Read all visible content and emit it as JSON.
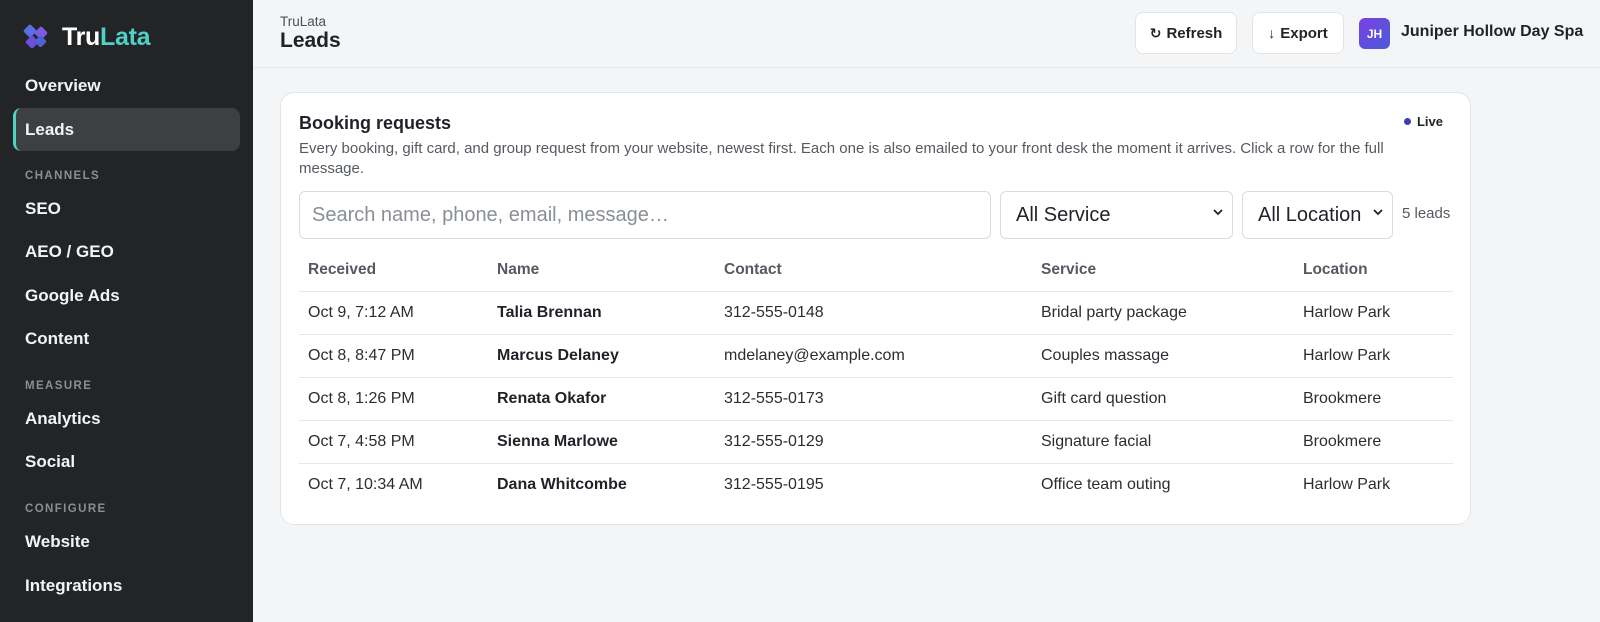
{
  "brand": {
    "name_part1": "Tru",
    "name_part2": "Lata",
    "accent": "#4fd1c5"
  },
  "sidebar": {
    "items": [
      {
        "label": "Overview"
      },
      {
        "label": "Leads",
        "active": true
      }
    ],
    "sections": [
      {
        "title": "CHANNELS",
        "items": [
          {
            "label": "SEO"
          },
          {
            "label": "AEO / GEO"
          },
          {
            "label": "Google Ads"
          },
          {
            "label": "Content"
          }
        ]
      },
      {
        "title": "MEASURE",
        "items": [
          {
            "label": "Analytics"
          },
          {
            "label": "Social"
          }
        ]
      },
      {
        "title": "CONFIGURE",
        "items": [
          {
            "label": "Website"
          },
          {
            "label": "Integrations"
          }
        ]
      }
    ]
  },
  "header": {
    "breadcrumb": "TruLata",
    "title": "Leads",
    "refresh_label": "Refresh",
    "export_label": "Export",
    "account": {
      "initials": "JH",
      "name": "Juniper Hollow Day Spa"
    }
  },
  "card": {
    "title": "Booking requests",
    "live_label": "Live",
    "description": "Every booking, gift card, and group request from your website, newest first. Each one is also emailed to your front desk the moment it arrives. Click a row for the full message.",
    "search_placeholder": "Search name, phone, email, message…",
    "service_filter": "All Service",
    "location_filter": "All Location",
    "lead_count": "5 leads"
  },
  "table": {
    "columns": [
      "Received",
      "Name",
      "Contact",
      "Service",
      "Location"
    ],
    "rows": [
      {
        "received": "Oct 9, 7:12 AM",
        "name": "Talia Brennan",
        "contact": "312-555-0148",
        "service": "Bridal party package",
        "location": "Harlow Park"
      },
      {
        "received": "Oct 8, 8:47 PM",
        "name": "Marcus Delaney",
        "contact": "mdelaney@example.com",
        "service": "Couples massage",
        "location": "Harlow Park"
      },
      {
        "received": "Oct 8, 1:26 PM",
        "name": "Renata Okafor",
        "contact": "312-555-0173",
        "service": "Gift card question",
        "location": "Brookmere"
      },
      {
        "received": "Oct 7, 4:58 PM",
        "name": "Sienna Marlowe",
        "contact": "312-555-0129",
        "service": "Signature facial",
        "location": "Brookmere"
      },
      {
        "received": "Oct 7, 10:34 AM",
        "name": "Dana Whitcombe",
        "contact": "312-555-0195",
        "service": "Office team outing",
        "location": "Harlow Park"
      }
    ]
  }
}
